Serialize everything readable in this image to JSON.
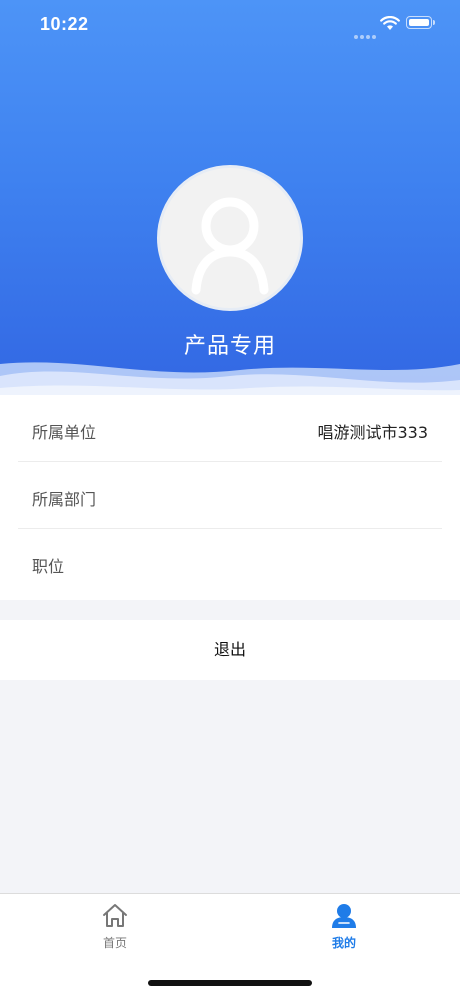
{
  "status_bar": {
    "time": "10:22"
  },
  "profile": {
    "name": "产品专用"
  },
  "info": {
    "rows": [
      {
        "label": "所属单位",
        "value": "唱游测试市333"
      },
      {
        "label": "所属部门",
        "value": ""
      },
      {
        "label": "职位",
        "value": ""
      }
    ]
  },
  "logout_label": "退出",
  "tabbar": {
    "home_label": "首页",
    "mine_label": "我的",
    "active_color": "#1f7ce8",
    "inactive_color": "#777777"
  },
  "colors": {
    "header_top": "#4d94f7",
    "header_bottom": "#3267e3"
  }
}
